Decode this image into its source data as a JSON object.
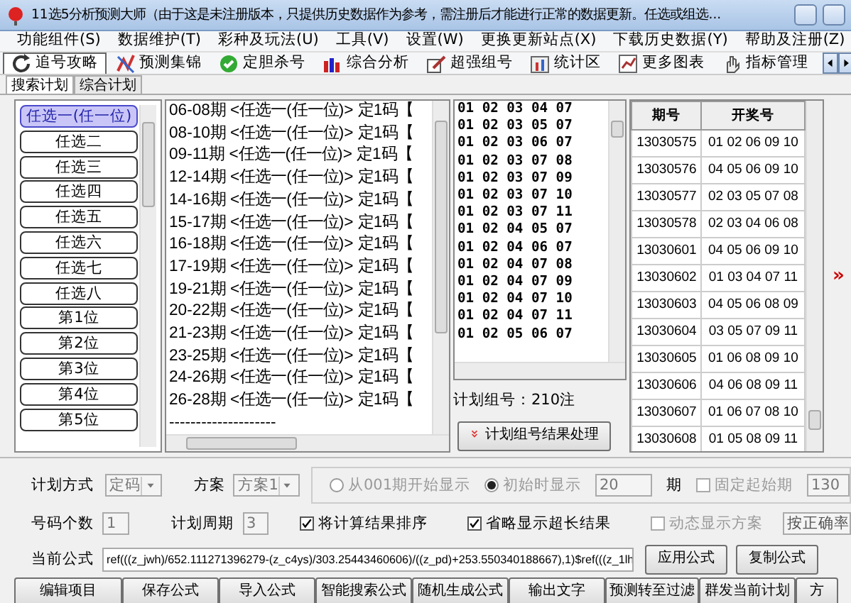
{
  "window": {
    "title": "11选5分析预测大师（由于这是未注册版本，只提供历史数据作为参考，需注册后才能进行正常的数据更新。任选或组选..."
  },
  "menu": [
    "功能组件(S)",
    "数据维护(T)",
    "彩种及玩法(U)",
    "工具(V)",
    "设置(W)",
    "更换更新站点(X)",
    "下载历史数据(Y)",
    "帮助及注册(Z)"
  ],
  "toolbar": [
    {
      "label": "追号攻略",
      "kind": "refresh",
      "selected": true
    },
    {
      "label": "预测集锦",
      "kind": "chart",
      "selected": false
    },
    {
      "label": "定胆杀号",
      "kind": "check",
      "selected": false
    },
    {
      "label": "综合分析",
      "kind": "bars",
      "selected": false
    },
    {
      "label": "超强组号",
      "kind": "pen",
      "selected": false
    },
    {
      "label": "统计区",
      "kind": "stats",
      "selected": false
    },
    {
      "label": "更多图表",
      "kind": "graph",
      "selected": false
    },
    {
      "label": "指标管理",
      "kind": "hand",
      "selected": false
    }
  ],
  "tabs": [
    {
      "label": "搜索计划",
      "selected": true
    },
    {
      "label": "综合计划",
      "selected": false
    }
  ],
  "play_types": [
    {
      "label": "任选一(任一位)",
      "selected": true
    },
    {
      "label": "任选二",
      "selected": false
    },
    {
      "label": "任选三",
      "selected": false
    },
    {
      "label": "任选四",
      "selected": false
    },
    {
      "label": "任选五",
      "selected": false
    },
    {
      "label": "任选六",
      "selected": false
    },
    {
      "label": "任选七",
      "selected": false
    },
    {
      "label": "任选八",
      "selected": false
    },
    {
      "label": "第1位",
      "selected": false
    },
    {
      "label": "第2位",
      "selected": false
    },
    {
      "label": "第3位",
      "selected": false
    },
    {
      "label": "第4位",
      "selected": false
    },
    {
      "label": "第5位",
      "selected": false
    }
  ],
  "plan_results": [
    "06-08期 <任选一(任一位)> 定1码【",
    "08-10期 <任选一(任一位)> 定1码【",
    "09-11期 <任选一(任一位)> 定1码【",
    "12-14期 <任选一(任一位)> 定1码【",
    "14-16期 <任选一(任一位)> 定1码【",
    "15-17期 <任选一(任一位)> 定1码【",
    "16-18期 <任选一(任一位)> 定1码【",
    "17-19期 <任选一(任一位)> 定1码【",
    "19-21期 <任选一(任一位)> 定1码【",
    "20-22期 <任选一(任一位)> 定1码【",
    "21-23期 <任选一(任一位)> 定1码【",
    "23-25期 <任选一(任一位)> 定1码【",
    "24-26期 <任选一(任一位)> 定1码【",
    "26-28期 <任选一(任一位)> 定1码【",
    "--------------------"
  ],
  "combinations": [
    "01 02 03 04 07",
    "01 02 03 05 07",
    "01 02 03 06 07",
    "01 02 03 07 08",
    "01 02 03 07 09",
    "01 02 03 07 10",
    "01 02 03 07 11",
    "01 02 04 05 07",
    "01 02 04 06 07",
    "01 02 04 07 08",
    "01 02 04 07 09",
    "01 02 04 07 10",
    "01 02 04 07 11",
    "01 02 05 06 07"
  ],
  "combination_count": "计划组号：210注",
  "process_button": "计划组号结果处理",
  "draw_table": {
    "columns": [
      "期号",
      "开奖号"
    ],
    "rows": [
      [
        "13030575",
        "01 02 06 09 10"
      ],
      [
        "13030576",
        "04 05 06 09 10"
      ],
      [
        "13030577",
        "02 03 05 07 08"
      ],
      [
        "13030578",
        "02 03 04 06 08"
      ],
      [
        "13030601",
        "04 05 06 09 10"
      ],
      [
        "13030602",
        "01 03 04 07 11"
      ],
      [
        "13030603",
        "04 05 06 08 09"
      ],
      [
        "13030604",
        "03 05 07 09 11"
      ],
      [
        "13030605",
        "01 06 08 09 10"
      ],
      [
        "13030606",
        "04 06 08 09 11"
      ],
      [
        "13030607",
        "01 06 07 08 10"
      ],
      [
        "13030608",
        "01 05 08 09 11"
      ]
    ]
  },
  "expand_marker": "»",
  "settings": {
    "plan_mode_label": "计划方式",
    "plan_mode": "定码",
    "scheme_label": "方案",
    "scheme": "方案1",
    "radios": [
      {
        "label": "从001期开始显示",
        "selected": false,
        "disabled": true
      },
      {
        "label": "初始时显示",
        "selected": true,
        "disabled": true
      }
    ],
    "periods_value": "20",
    "periods_unit": "期",
    "fixed_start": {
      "label": "固定起始期",
      "checked": false,
      "disabled": true
    },
    "start_value": "130",
    "count_label": "号码个数",
    "count_value": "1",
    "cycle_label": "计划周期",
    "cycle_value": "3",
    "checks": [
      {
        "label": "将计算结果排序",
        "checked": true,
        "disabled": false
      },
      {
        "label": "省略显示超长结果",
        "checked": true,
        "disabled": false
      },
      {
        "label": "动态显示方案",
        "checked": false,
        "disabled": true
      }
    ],
    "sort_value": "按正确率",
    "formula_label": "当前公式",
    "formula": "ref(((z_jwh)/652.111271396279-(z_c4ys)/303.25443460606)/((z_pd)+253.550340188667),1)$ref(((z_1lh",
    "formula_buttons": [
      "应用公式",
      "复制公式"
    ]
  },
  "bottom_buttons": [
    "编辑项目",
    "保存公式",
    "导入公式",
    "智能搜索公式",
    "随机生成公式",
    "输出文字",
    "预测转至过滤",
    "群发当前计划",
    "方"
  ]
}
